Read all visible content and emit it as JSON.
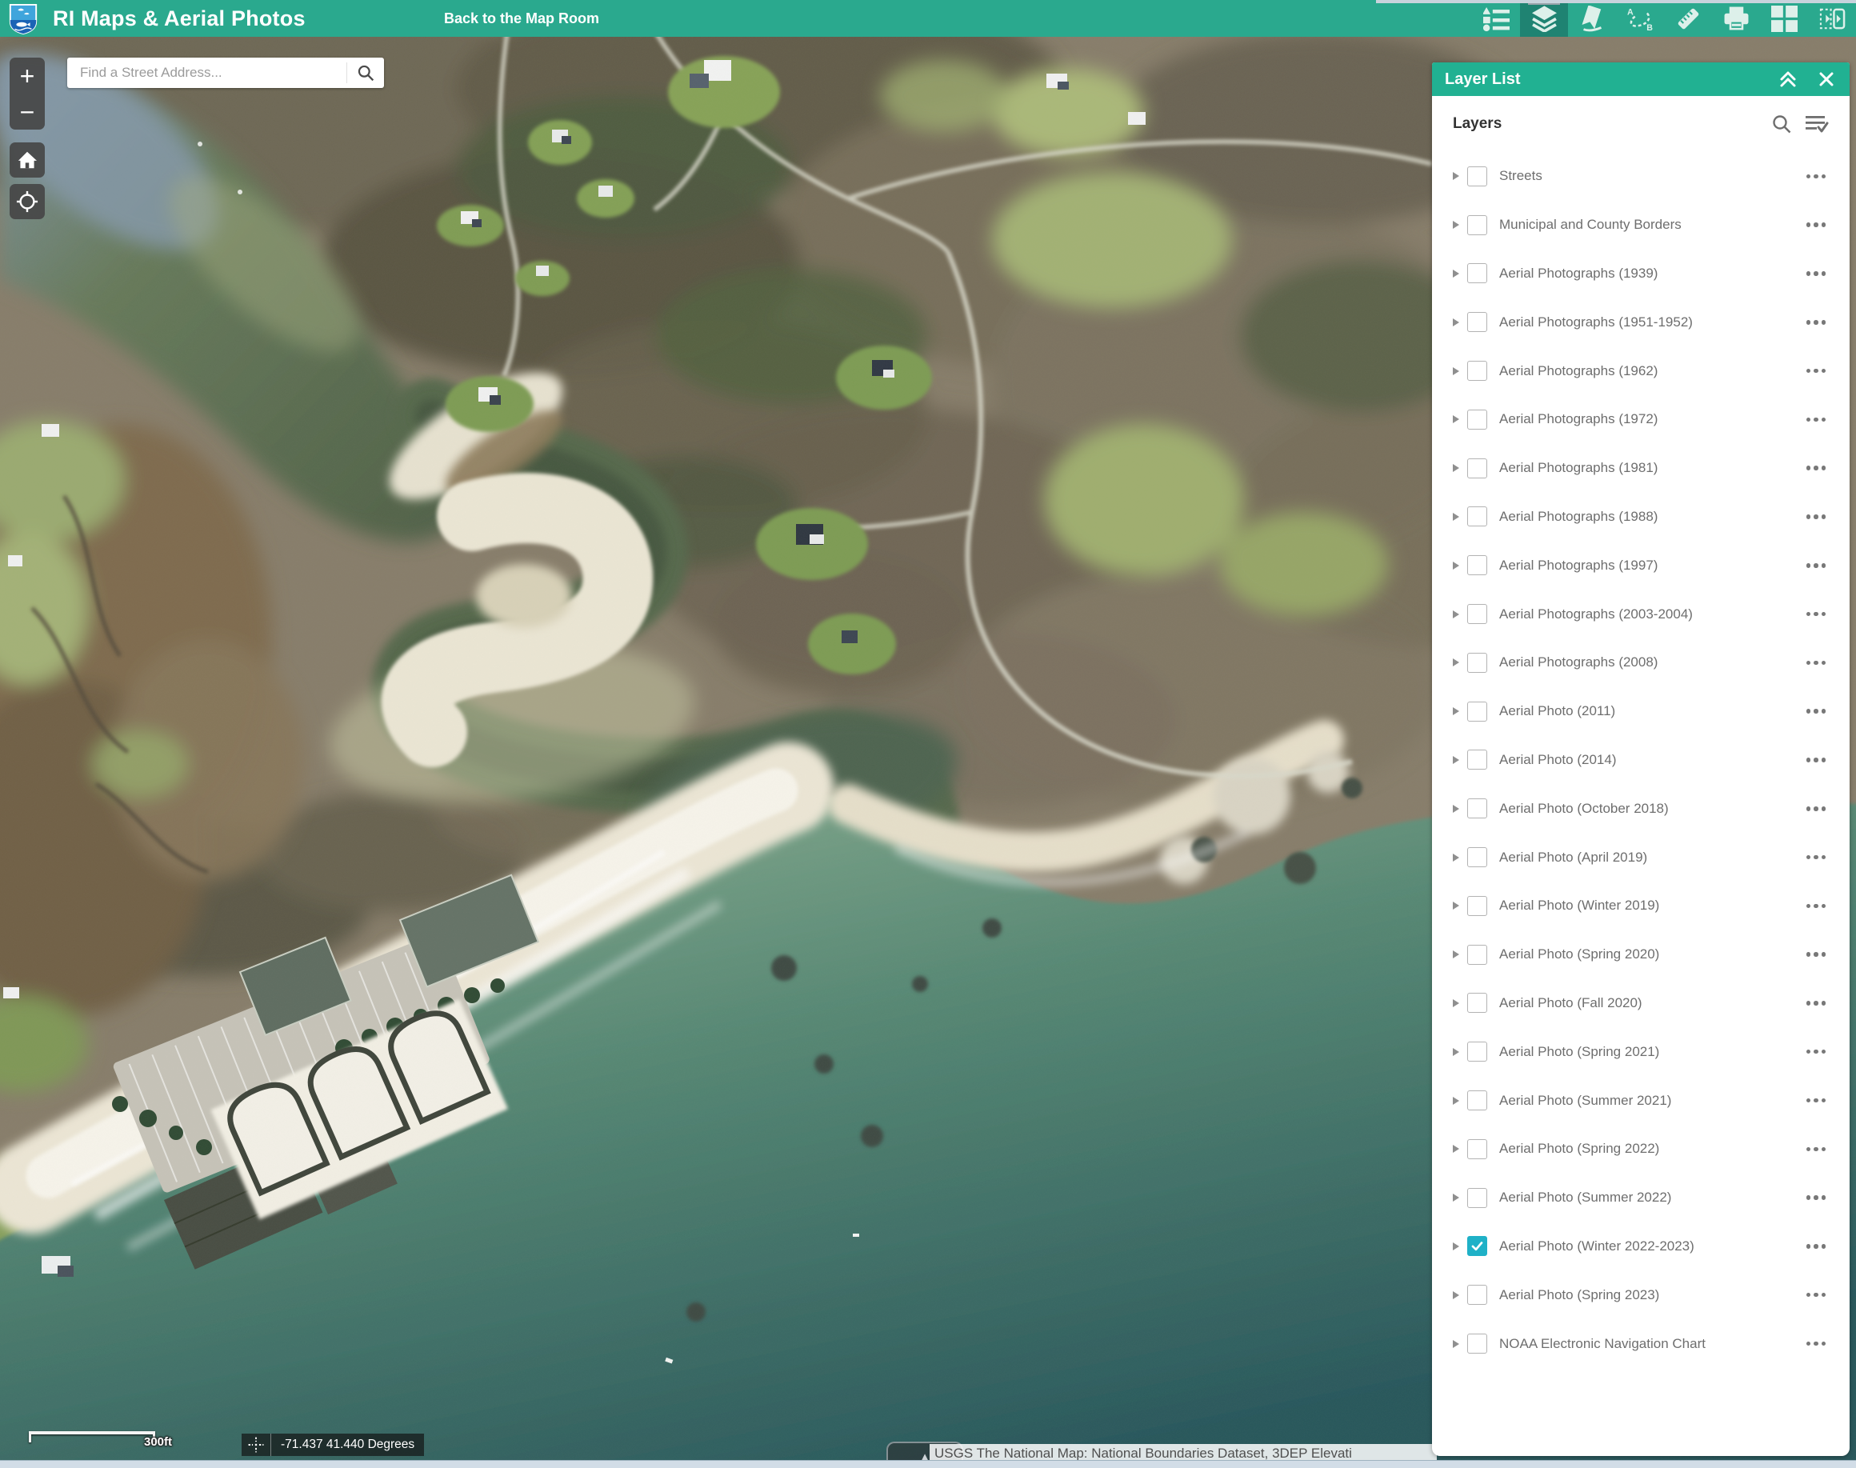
{
  "app": {
    "title": "RI Maps & Aerial Photos",
    "back_link": "Back to the Map Room"
  },
  "colors": {
    "header_teal": "#2aa98e",
    "panel_header_teal": "#21b192",
    "active_tool_teal": "#1f8372",
    "checked_checkbox_cyan": "#1fb1c7"
  },
  "toolbar": {
    "tools": [
      {
        "icon": "legend-icon",
        "active": false
      },
      {
        "icon": "layers-icon",
        "active": true
      },
      {
        "icon": "bookmark-icon",
        "active": false
      },
      {
        "icon": "draw-ab-icon",
        "active": false
      },
      {
        "icon": "measure-icon",
        "active": false
      },
      {
        "icon": "print-icon",
        "active": false
      },
      {
        "icon": "basemap-gallery-icon",
        "active": false
      },
      {
        "icon": "swipe-icon",
        "active": false
      }
    ]
  },
  "search": {
    "placeholder": "Find a Street Address..."
  },
  "map_controls": {
    "zoom_in_label": "+",
    "zoom_out_label": "−",
    "home_icon": "home-icon",
    "locate_icon": "locate-icon"
  },
  "layer_list": {
    "panel_title": "Layer List",
    "section_title": "Layers",
    "layers": [
      {
        "label": "Streets",
        "checked": false
      },
      {
        "label": "Municipal and County Borders",
        "checked": false
      },
      {
        "label": "Aerial Photographs (1939)",
        "checked": false
      },
      {
        "label": "Aerial Photographs (1951-1952)",
        "checked": false
      },
      {
        "label": "Aerial Photographs (1962)",
        "checked": false
      },
      {
        "label": "Aerial Photographs (1972)",
        "checked": false
      },
      {
        "label": "Aerial Photographs (1981)",
        "checked": false
      },
      {
        "label": "Aerial Photographs (1988)",
        "checked": false
      },
      {
        "label": "Aerial Photographs (1997)",
        "checked": false
      },
      {
        "label": "Aerial Photographs (2003-2004)",
        "checked": false
      },
      {
        "label": "Aerial Photographs (2008)",
        "checked": false
      },
      {
        "label": "Aerial Photo (2011)",
        "checked": false
      },
      {
        "label": "Aerial Photo (2014)",
        "checked": false
      },
      {
        "label": "Aerial Photo (October 2018)",
        "checked": false
      },
      {
        "label": "Aerial Photo (April 2019)",
        "checked": false
      },
      {
        "label": "Aerial Photo (Winter 2019)",
        "checked": false
      },
      {
        "label": "Aerial Photo (Spring 2020)",
        "checked": false
      },
      {
        "label": "Aerial Photo (Fall 2020)",
        "checked": false
      },
      {
        "label": "Aerial Photo (Spring 2021)",
        "checked": false
      },
      {
        "label": "Aerial Photo (Summer 2021)",
        "checked": false
      },
      {
        "label": "Aerial Photo (Spring 2022)",
        "checked": false
      },
      {
        "label": "Aerial Photo (Summer 2022)",
        "checked": false
      },
      {
        "label": "Aerial Photo (Winter 2022-2023)",
        "checked": true
      },
      {
        "label": "Aerial Photo (Spring 2023)",
        "checked": false
      },
      {
        "label": "NOAA Electronic Navigation Chart",
        "checked": false
      }
    ]
  },
  "map_status": {
    "scale_label": "300ft",
    "coordinates": "-71.437 41.440 Degrees",
    "attribution": "USGS The National Map: National Boundaries Dataset, 3DEP Elevati"
  }
}
